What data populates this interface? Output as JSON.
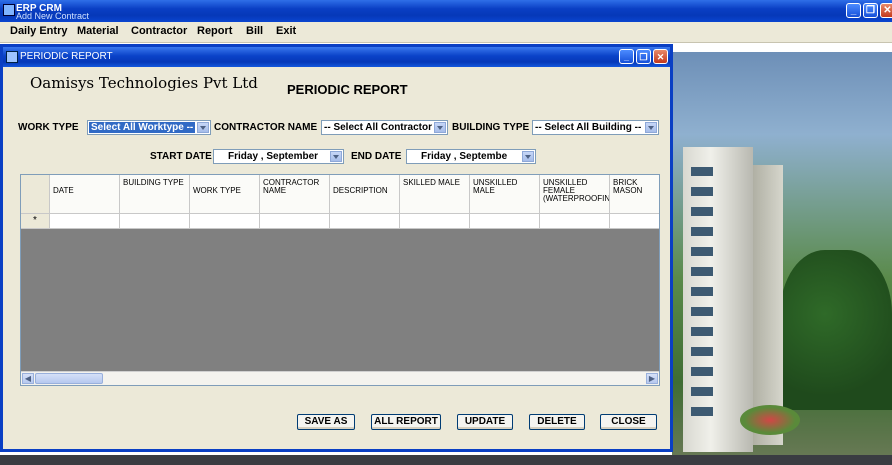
{
  "window": {
    "title": "ERP CRM",
    "subtitle": "Add New Contract",
    "controls": {
      "minimize": "_",
      "restore": "❐",
      "close": "✕"
    }
  },
  "menu": [
    "Daily Entry",
    "Material",
    "Contractor",
    "Report",
    "Bill",
    "Exit"
  ],
  "dialog": {
    "title": "PERIODIC REPORT",
    "company": "Oamisys Technologies Pvt Ltd",
    "heading": "PERIODIC REPORT",
    "filters": {
      "work_type": {
        "label": "WORK TYPE",
        "value": "Select All Worktype --"
      },
      "contractor_name": {
        "label": "CONTRACTOR NAME",
        "value": "-- Select All Contractor"
      },
      "building_type": {
        "label": "BUILDING TYPE",
        "value": "-- Select All Building --"
      },
      "start_date": {
        "label": "START DATE",
        "value": "Friday    , September"
      },
      "end_date": {
        "label": "END DATE",
        "value": "Friday    , Septembe"
      }
    },
    "grid": {
      "columns": [
        "DATE",
        "BUILDING TYPE",
        "WORK TYPE",
        "CONTRACTOR NAME",
        "DESCRIPTION",
        "SKILLED MALE",
        "UNSKILLED MALE",
        "UNSKILLED FEMALE (WATERPROOFIN",
        "BRICK MASON"
      ],
      "new_row_marker": "*"
    },
    "buttons": {
      "save_as": "SAVE AS",
      "all_report": "ALL REPORT",
      "update": "UPDATE",
      "delete": "DELETE",
      "close": "CLOSE"
    }
  },
  "colors": {
    "titlebar": "#0a3fc4",
    "selection": "#316ac5",
    "dialog_bg": "#ece9d8",
    "grid_empty": "#808080"
  }
}
